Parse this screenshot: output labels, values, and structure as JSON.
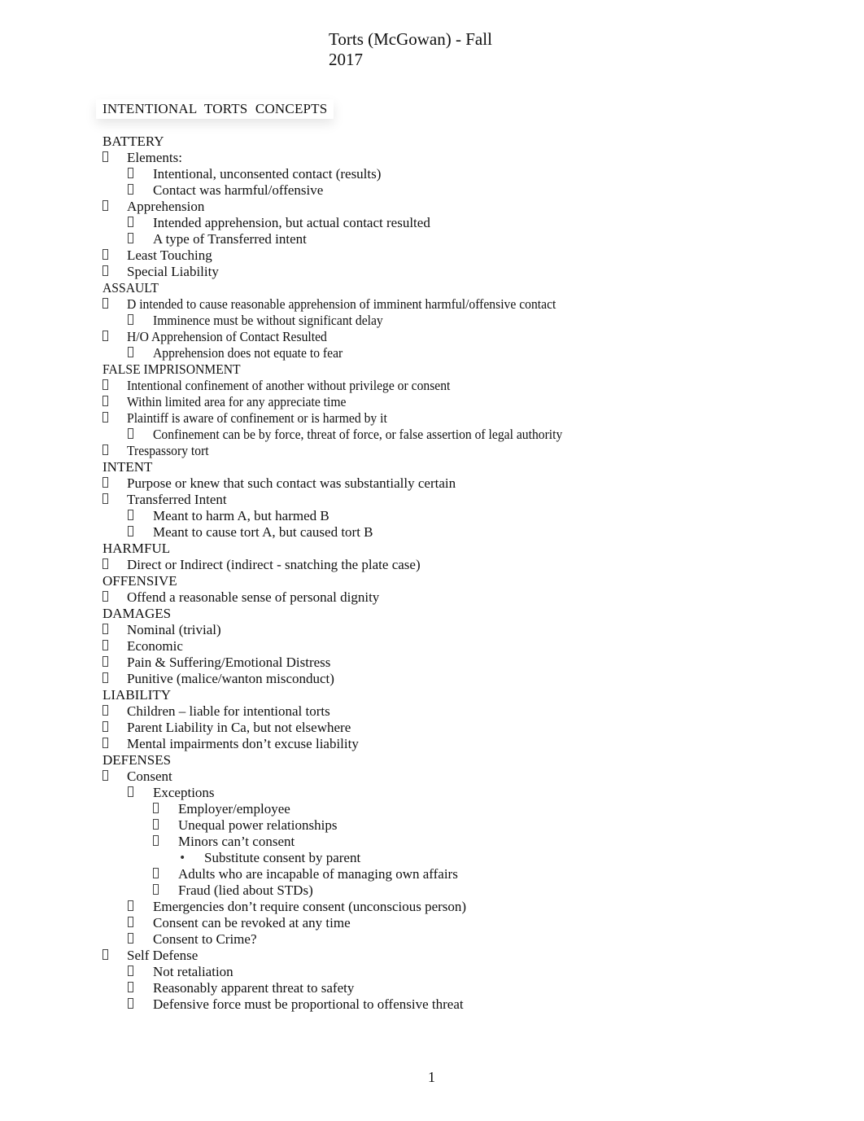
{
  "document": {
    "title_line1": "Torts (McGowan) - Fall",
    "title_line2": "2017",
    "heading": "INTENTIONAL  TORTS  CONCEPTS",
    "page_number": "1"
  },
  "outline": [
    {
      "type": "section",
      "text": "BATTERY"
    },
    {
      "type": "item",
      "level": 1,
      "bullet": "tofu",
      "text": "Elements:"
    },
    {
      "type": "item",
      "level": 2,
      "bullet": "tofu",
      "text": "Intentional, unconsented contact (results)"
    },
    {
      "type": "item",
      "level": 2,
      "bullet": "tofu",
      "text": "Contact was harmful/offensive"
    },
    {
      "type": "item",
      "level": 1,
      "bullet": "tofu",
      "text": "Apprehension"
    },
    {
      "type": "item",
      "level": 2,
      "bullet": "tofu",
      "text": "Intended apprehension, but actual contact resulted"
    },
    {
      "type": "item",
      "level": 2,
      "bullet": "tofu",
      "text": "A type of Transferred intent"
    },
    {
      "type": "item",
      "level": 1,
      "bullet": "tofu",
      "text": "Least Touching"
    },
    {
      "type": "item",
      "level": 1,
      "bullet": "tofu",
      "text": "Special Liability"
    },
    {
      "type": "section",
      "text": "ASSAULT",
      "condensed": true
    },
    {
      "type": "item",
      "level": 1,
      "bullet": "tofu",
      "text": "D intended to cause reasonable apprehension of imminent harmful/offensive contact",
      "condensed": true
    },
    {
      "type": "item",
      "level": 2,
      "bullet": "tofu",
      "text": "Imminence must be without significant delay",
      "condensed": true
    },
    {
      "type": "item",
      "level": 1,
      "bullet": "tofu",
      "text": "H/O Apprehension of Contact Resulted",
      "condensed": true
    },
    {
      "type": "item",
      "level": 2,
      "bullet": "tofu",
      "text": "Apprehension does not equate to fear",
      "condensed": true
    },
    {
      "type": "section",
      "text": "FALSE IMPRISONMENT",
      "condensed": true
    },
    {
      "type": "item",
      "level": 1,
      "bullet": "tofu",
      "text": "Intentional confinement of another without privilege or consent",
      "condensed": true
    },
    {
      "type": "item",
      "level": 1,
      "bullet": "tofu",
      "text": "Within limited area for any appreciate time",
      "condensed": true
    },
    {
      "type": "item",
      "level": 1,
      "bullet": "tofu",
      "text": "Plaintiff is aware of confinement or is harmed by it",
      "condensed": true
    },
    {
      "type": "item",
      "level": 2,
      "bullet": "tofu",
      "text": "Confinement can be by force, threat of force, or false assertion of legal authority",
      "condensed": true
    },
    {
      "type": "item",
      "level": 1,
      "bullet": "tofu",
      "text": "Trespassory tort",
      "condensed": true
    },
    {
      "type": "section",
      "text": "INTENT"
    },
    {
      "type": "item",
      "level": 1,
      "bullet": "tofu",
      "text": "Purpose or knew that such contact was substantially certain"
    },
    {
      "type": "item",
      "level": 1,
      "bullet": "tofu",
      "text": "Transferred Intent"
    },
    {
      "type": "item",
      "level": 2,
      "bullet": "tofu",
      "text": "Meant to harm A, but harmed B"
    },
    {
      "type": "item",
      "level": 2,
      "bullet": "tofu",
      "text": "Meant to cause tort A, but caused tort B"
    },
    {
      "type": "section",
      "text": "HARMFUL"
    },
    {
      "type": "item",
      "level": 1,
      "bullet": "tofu",
      "text": "Direct or Indirect (indirect - snatching the plate case)"
    },
    {
      "type": "section",
      "text": "OFFENSIVE"
    },
    {
      "type": "item",
      "level": 1,
      "bullet": "tofu",
      "text": "Offend a reasonable sense of personal dignity"
    },
    {
      "type": "section",
      "text": "DAMAGES"
    },
    {
      "type": "item",
      "level": 1,
      "bullet": "tofu",
      "text": "Nominal (trivial)"
    },
    {
      "type": "item",
      "level": 1,
      "bullet": "tofu",
      "text": "Economic"
    },
    {
      "type": "item",
      "level": 1,
      "bullet": "tofu",
      "text": "Pain & Suffering/Emotional Distress"
    },
    {
      "type": "item",
      "level": 1,
      "bullet": "tofu",
      "text": "Punitive (malice/wanton misconduct)"
    },
    {
      "type": "section",
      "text": "LIABILITY"
    },
    {
      "type": "item",
      "level": 1,
      "bullet": "tofu",
      "text": "Children – liable for intentional torts"
    },
    {
      "type": "item",
      "level": 1,
      "bullet": "tofu",
      "text": "Parent Liability in Ca, but not elsewhere"
    },
    {
      "type": "item",
      "level": 1,
      "bullet": "tofu",
      "text": "Mental impairments don’t excuse liability"
    },
    {
      "type": "section",
      "text": "DEFENSES"
    },
    {
      "type": "item",
      "level": 1,
      "bullet": "tofu",
      "text": "Consent"
    },
    {
      "type": "item",
      "level": 2,
      "bullet": "tofu",
      "text": "Exceptions"
    },
    {
      "type": "item",
      "level": 3,
      "bullet": "tofu",
      "text": "Employer/employee"
    },
    {
      "type": "item",
      "level": 3,
      "bullet": "tofu",
      "text": "Unequal power relationships"
    },
    {
      "type": "item",
      "level": 3,
      "bullet": "tofu",
      "text": "Minors can’t consent"
    },
    {
      "type": "item",
      "level": 4,
      "bullet": "•",
      "text": "Substitute consent by parent"
    },
    {
      "type": "item",
      "level": 3,
      "bullet": "tofu",
      "text": "Adults who are incapable of managing own affairs"
    },
    {
      "type": "item",
      "level": 3,
      "bullet": "tofu",
      "text": "Fraud (lied about STDs)"
    },
    {
      "type": "item",
      "level": 2,
      "bullet": "tofu",
      "text": "Emergencies don’t require consent (unconscious person)"
    },
    {
      "type": "item",
      "level": 2,
      "bullet": "tofu",
      "text": "Consent can be revoked at any time"
    },
    {
      "type": "item",
      "level": 2,
      "bullet": "tofu",
      "text": "Consent to Crime?"
    },
    {
      "type": "item",
      "level": 1,
      "bullet": "tofu",
      "text": "Self Defense"
    },
    {
      "type": "item",
      "level": 2,
      "bullet": "tofu",
      "text": "Not retaliation"
    },
    {
      "type": "item",
      "level": 2,
      "bullet": "tofu",
      "text": "Reasonably apparent threat to safety"
    },
    {
      "type": "item",
      "level": 2,
      "bullet": "tofu",
      "text": "Defensive force must be proportional to offensive threat"
    }
  ]
}
